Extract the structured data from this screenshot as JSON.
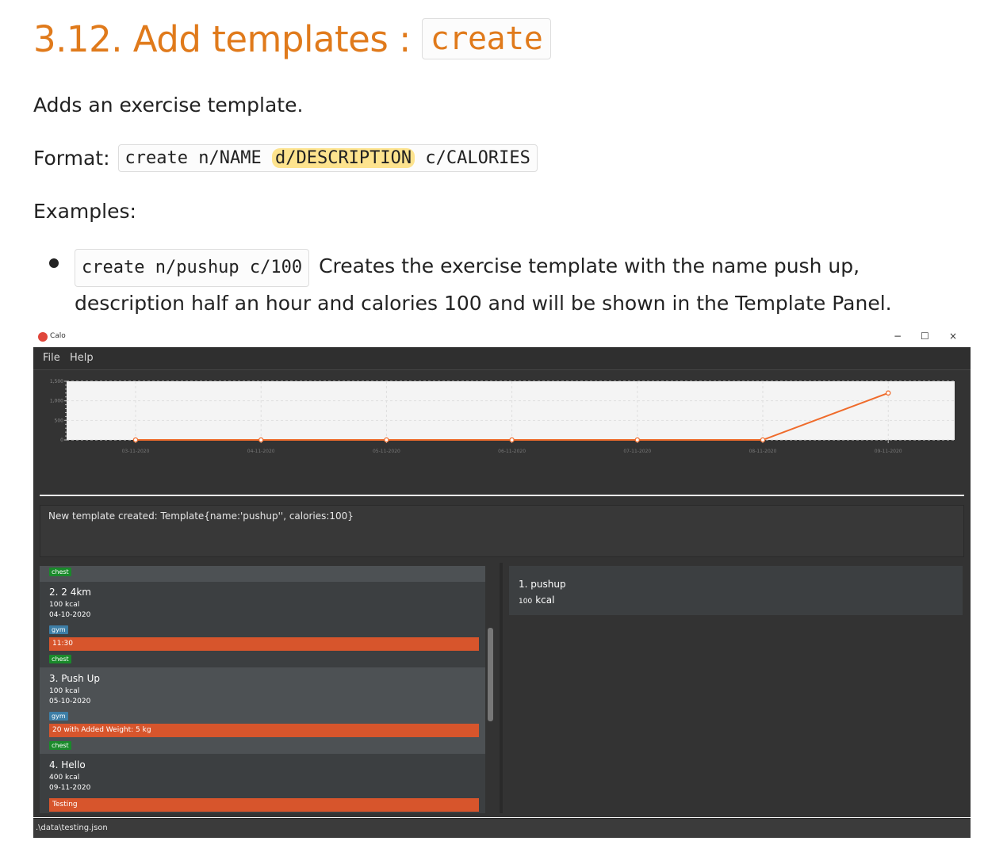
{
  "doc": {
    "heading_text": "3.12. Add templates :",
    "heading_code": "create",
    "intro": "Adds an exercise template.",
    "format_label": "Format:",
    "format_code_a": "create n/NAME ",
    "format_code_hl": "d/DESCRIPTION",
    "format_code_b": " c/CALORIES",
    "examples_label": "Examples:",
    "example_code": "create n/pushup c/100",
    "example_text": " Creates the exercise template with the name push up, description half an hour and calories 100 and will be shown in the Template Panel."
  },
  "app": {
    "window_title": "Calo",
    "minimize": "−",
    "maximize": "☐",
    "close": "×",
    "menu": [
      "File",
      "Help"
    ],
    "result_text": "New template created: Template{name:'pushup'', calories:100}",
    "status_path": ".\\data\\testing.json",
    "exercises": [
      {
        "tag_top": "chest"
      },
      {
        "title": "2.  2 4km",
        "calories": "100  kcal",
        "date": "04-10-2020",
        "tag_a": "gym",
        "bar": "11:30",
        "tag_b": "chest"
      },
      {
        "title": "3.  Push Up",
        "calories": "100  kcal",
        "date": "05-10-2020",
        "tag_a": "gym",
        "bar": "20 with Added Weight: 5 kg",
        "tag_b": "chest"
      },
      {
        "title": "4.  Hello",
        "calories": "400  kcal",
        "date": "09-11-2020",
        "bar": "Testing"
      }
    ],
    "templates": [
      {
        "title": "1.  pushup",
        "cal_num": "100",
        "cal_unit": "kcal"
      }
    ]
  },
  "chart_data": {
    "type": "line",
    "categories": [
      "03-11-2020",
      "04-11-2020",
      "05-11-2020",
      "06-11-2020",
      "07-11-2020",
      "08-11-2020",
      "09-11-2020"
    ],
    "series": [
      {
        "values": [
          0,
          0,
          0,
          0,
          0,
          0,
          1200
        ]
      }
    ],
    "yticks": [
      "0",
      "500",
      "1,000",
      "1,500"
    ],
    "ylim": [
      0,
      1500
    ],
    "grid": true,
    "line_color": "#ef6b2b"
  }
}
